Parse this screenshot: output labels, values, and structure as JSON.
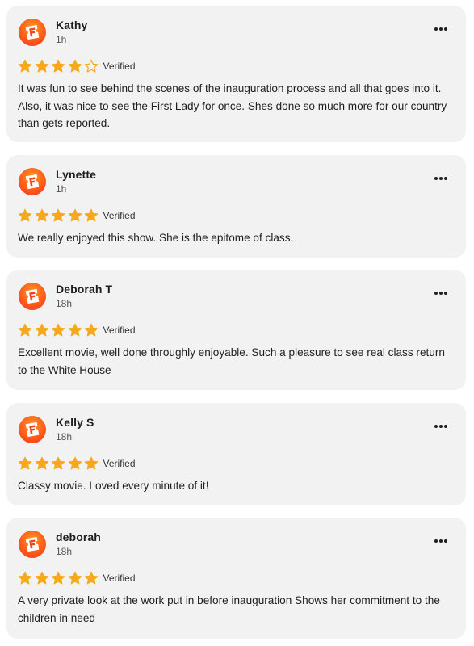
{
  "brand": {
    "avatar_icon": "fandango-logo-icon",
    "accent_color": "#ff5a1a",
    "star_color": "#f7a81b"
  },
  "reviews": [
    {
      "name": "Kathy",
      "time": "1h",
      "rating": 4,
      "max_rating": 5,
      "verified_label": "Verified",
      "text": "It was fun to see behind the scenes of the inauguration process and all that goes into it. Also, it was nice to see the First Lady for once. Shes done so much more for our country than gets reported."
    },
    {
      "name": "Lynette",
      "time": "1h",
      "rating": 5,
      "max_rating": 5,
      "verified_label": "Verified",
      "text": "We really enjoyed this show. She is the epitome of class."
    },
    {
      "name": "Deborah T",
      "time": "18h",
      "rating": 5,
      "max_rating": 5,
      "verified_label": "Verified",
      "text": "Excellent movie, well done throughly enjoyable. Such a pleasure to see real class return to the White House"
    },
    {
      "name": "Kelly S",
      "time": "18h",
      "rating": 5,
      "max_rating": 5,
      "verified_label": "Verified",
      "text": "Classy movie. Loved every minute of it!"
    },
    {
      "name": "deborah",
      "time": "18h",
      "rating": 5,
      "max_rating": 5,
      "verified_label": "Verified",
      "text": "A very private look at the work put in before inauguration Shows her commitment to the children in need"
    }
  ]
}
